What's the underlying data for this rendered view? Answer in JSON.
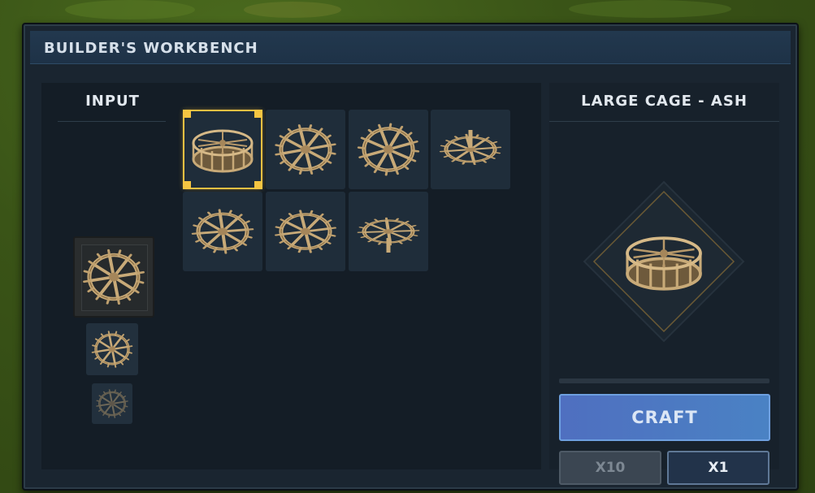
{
  "window": {
    "title": "BUILDER'S WORKBENCH"
  },
  "input_panel": {
    "header": "INPUT",
    "slots": [
      "wheel-icon",
      "wheel-icon",
      "wheel-icon"
    ]
  },
  "variants": {
    "selected_index": 0,
    "items": [
      "cage-icon",
      "wheel-icon",
      "wheel-icon",
      "wheel-icon",
      "wheel-icon",
      "wheel-icon",
      "wheel-icon"
    ]
  },
  "result_panel": {
    "header": "LARGE CAGE - ASH",
    "preview_icon": "cage-icon",
    "craft_progress": 0,
    "craft_label": "CRAFT",
    "quantity": {
      "x10_label": "X10",
      "x1_label": "X1",
      "selected": "X1"
    }
  },
  "colors": {
    "accent_selected": "#f5c542",
    "craft_button": "#4f7ac2",
    "panel": "#17212b"
  }
}
